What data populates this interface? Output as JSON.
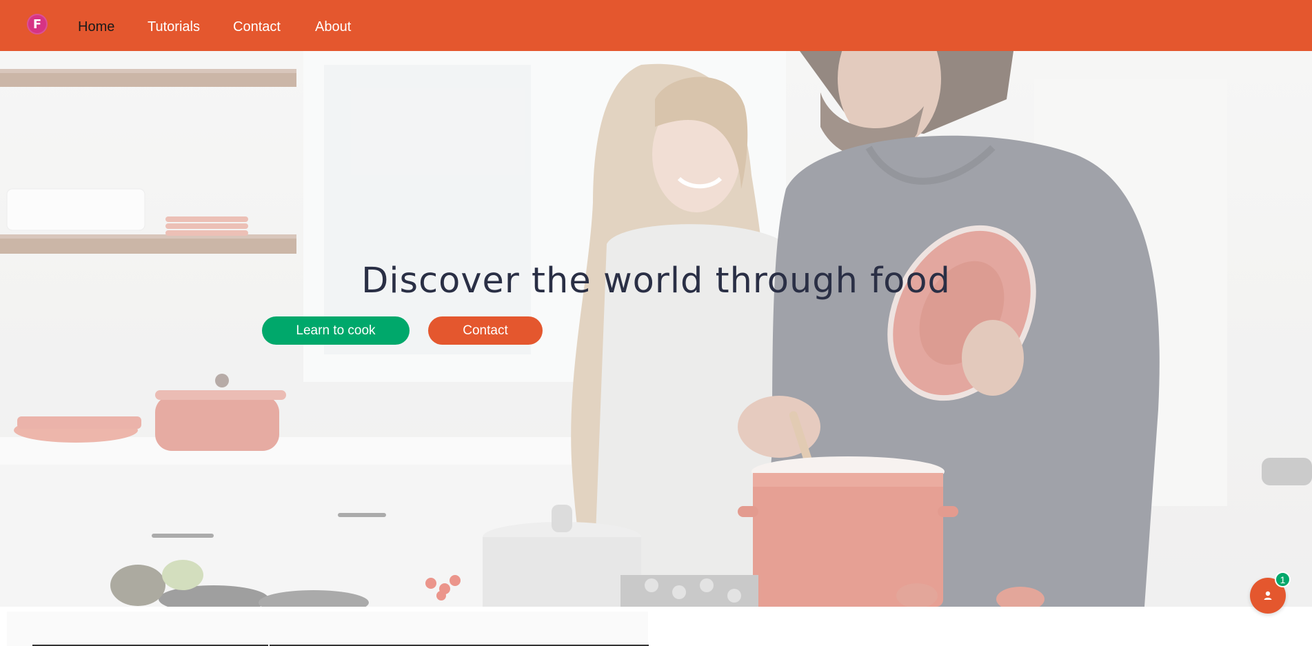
{
  "colors": {
    "brand": "#E4572E",
    "logo_bg": "#D63384",
    "primary_button": "#00A86B",
    "secondary_button": "#E4572E",
    "hero_title": "#2A2F45",
    "badge": "#00A86B"
  },
  "navbar": {
    "logo": {
      "letter": "F",
      "icon": "brand-logo-icon"
    },
    "links": [
      {
        "label": "Home",
        "active": true
      },
      {
        "label": "Tutorials",
        "active": false
      },
      {
        "label": "Contact",
        "active": false
      },
      {
        "label": "About",
        "active": false
      }
    ]
  },
  "hero": {
    "title": "Discover the world through food",
    "image": "couple-cooking-in-kitchen",
    "buttons": {
      "primary": "Learn to cook",
      "secondary": "Contact"
    }
  },
  "chat_widget": {
    "icon": "user-icon",
    "badge_count": "1"
  }
}
